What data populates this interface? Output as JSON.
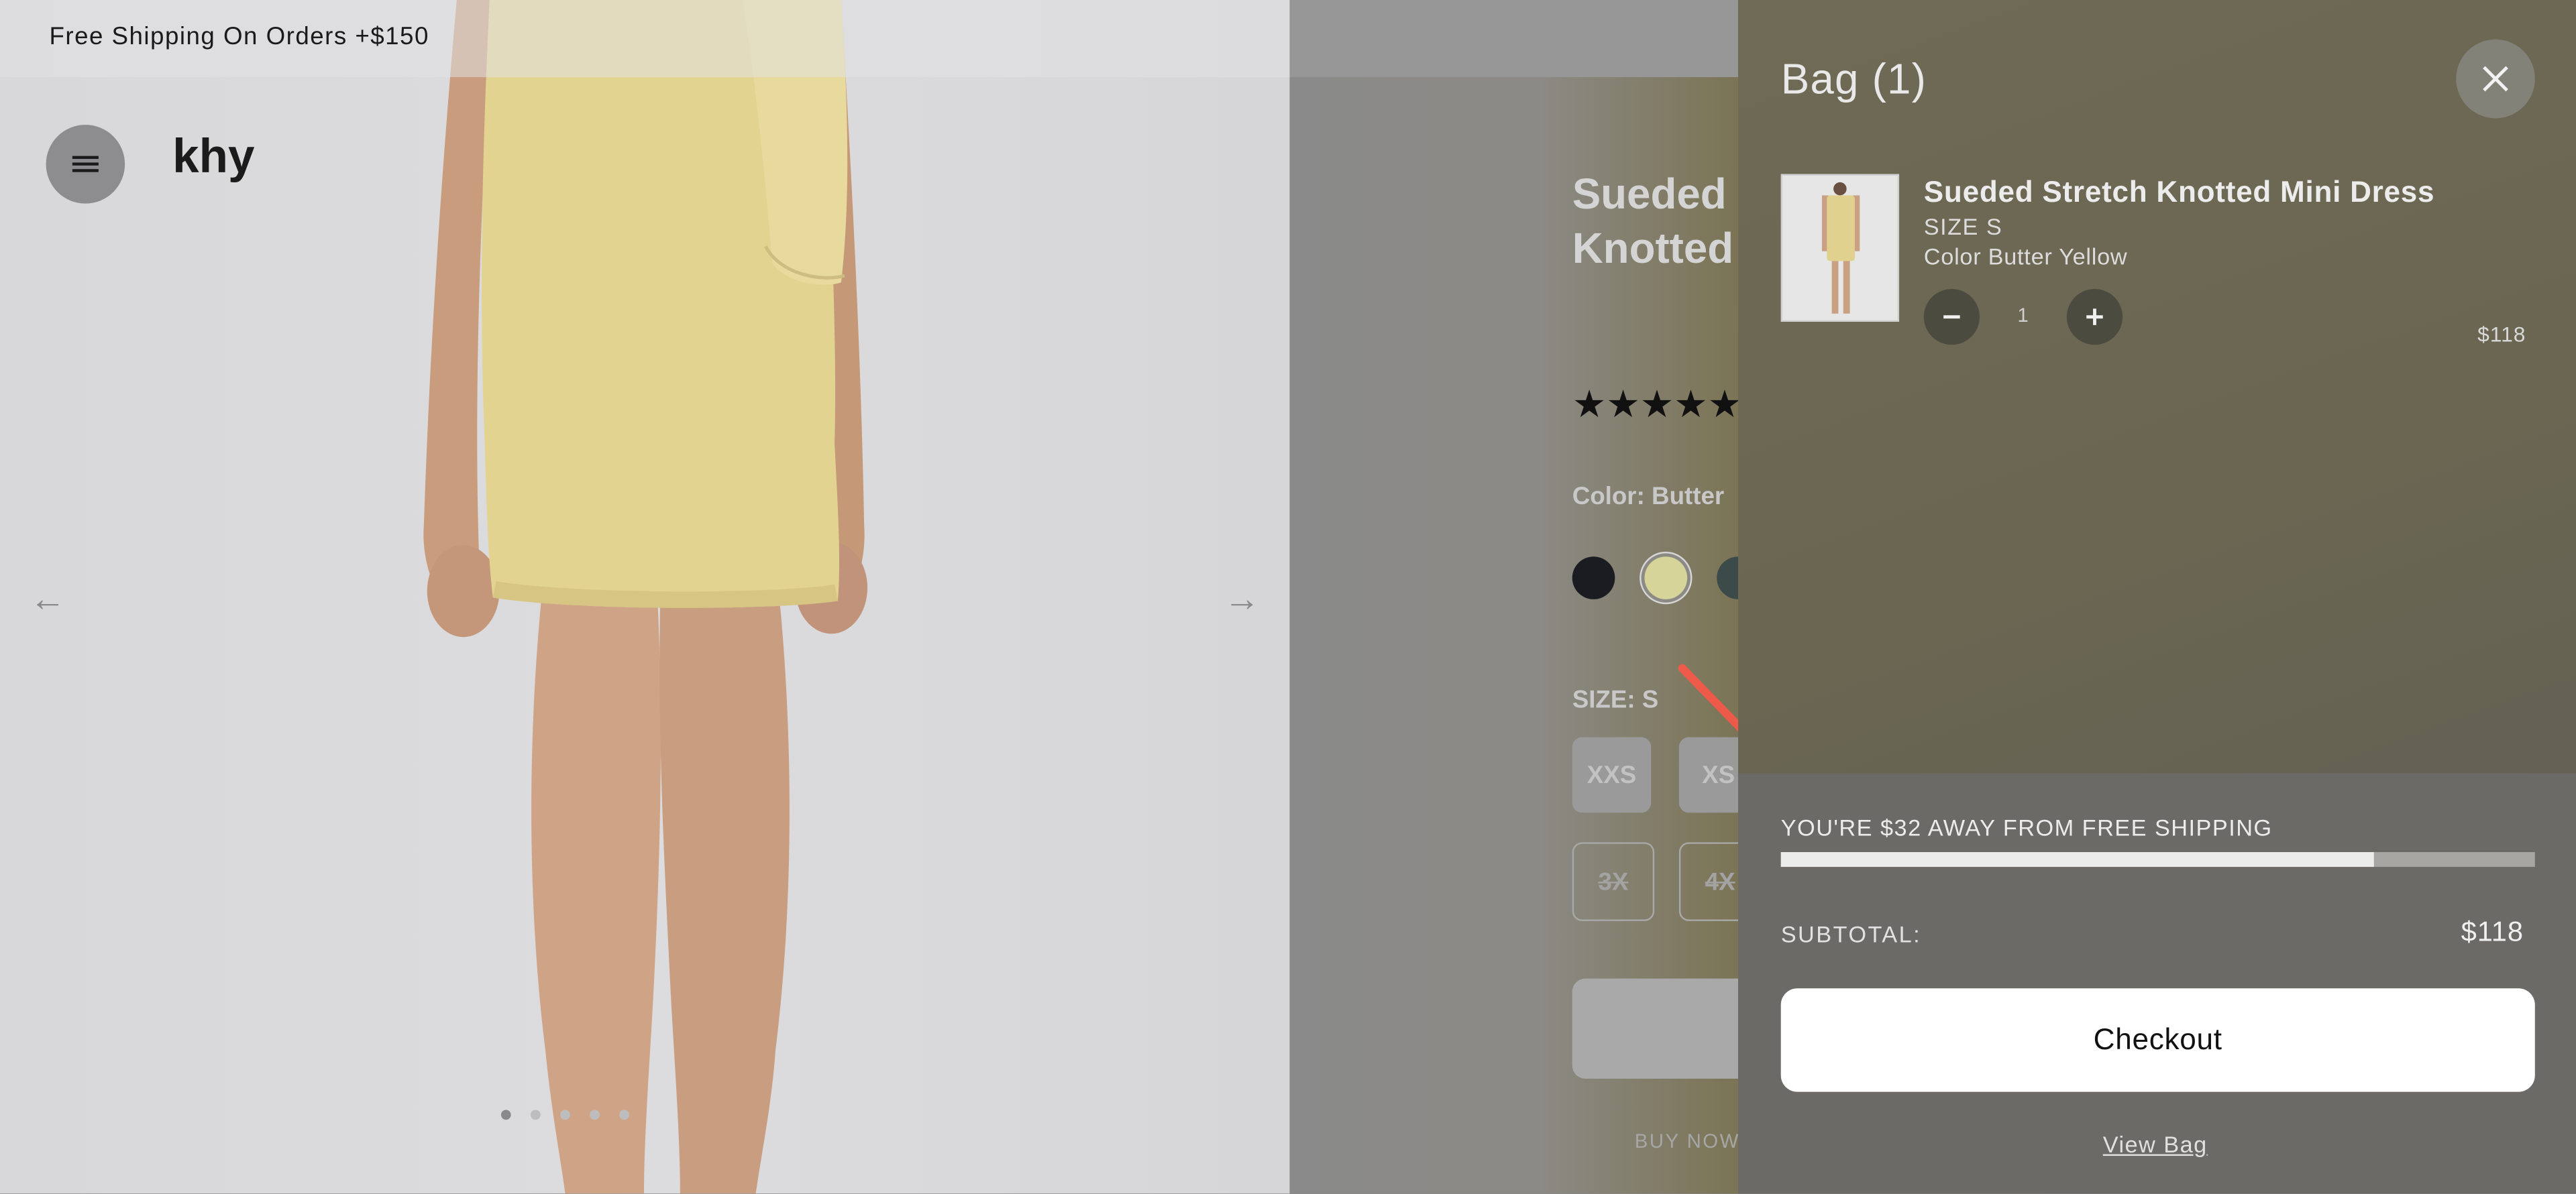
{
  "promo": {
    "text": "Free Shipping On Orders +$150"
  },
  "header": {
    "logo": "khy"
  },
  "product": {
    "title_line1": "Sueded",
    "title_line2": "Knotted",
    "rating_stars": "★★★★★",
    "color_label": "Color: Butter",
    "size_label": "SIZE: S",
    "sizes": [
      "XXS",
      "XS",
      "3X",
      "4X"
    ],
    "buy_now_text": "BUY NOW,",
    "swatch_colors": [
      "#1b1c22",
      "#d7d49a",
      "#3d4a4a"
    ]
  },
  "gallery": {
    "slide_count": 5,
    "active_slide": 0
  },
  "bag": {
    "title": "Bag (1)",
    "item": {
      "name": "Sueded Stretch Knotted Mini Dress",
      "size": "SIZE S",
      "color": "Color Butter Yellow",
      "quantity": "1",
      "price": "$118"
    },
    "shipping_message": "YOU'RE $32 AWAY FROM FREE SHIPPING",
    "shipping_progress": 0.787,
    "subtotal_label": "SUBTOTAL:",
    "subtotal_value": "$118",
    "checkout_label": "Checkout",
    "view_bag_label": "View Bag"
  },
  "colors": {
    "annotation_arrow": "#ee5a4a",
    "checkout_bg": "#ffffff"
  }
}
